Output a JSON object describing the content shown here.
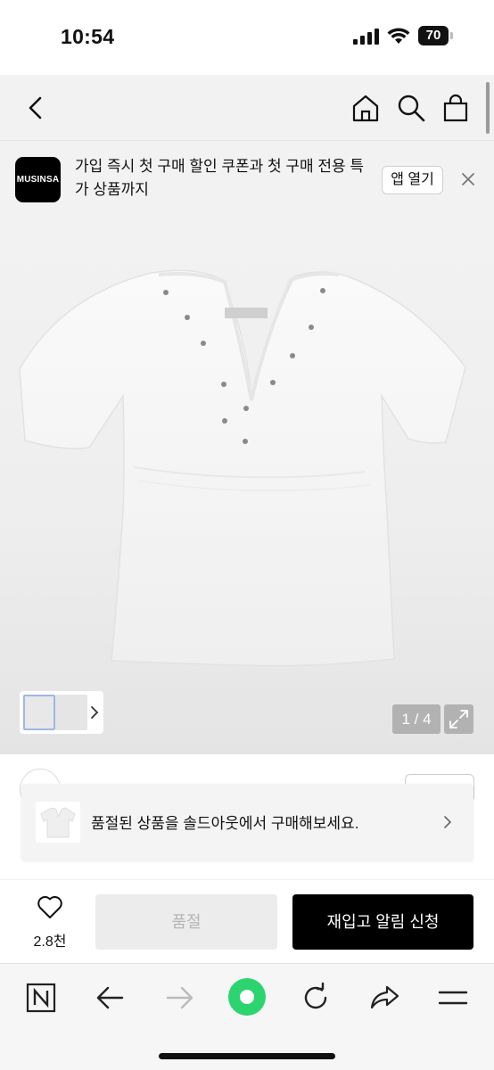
{
  "status_bar": {
    "time": "10:54",
    "battery": "70"
  },
  "top_nav": {
    "back_icon": "chevron-left-icon",
    "home_icon": "home-icon",
    "search_icon": "search-icon",
    "bag_icon": "shopping-bag-icon"
  },
  "promo": {
    "logo_text": "MUSINSA",
    "message": "가입 즉시 첫 구매 할인 쿠폰과 첫 구매 전용 특가 상품까지",
    "open_app_label": "앱 열기",
    "close_icon": "close-icon"
  },
  "gallery": {
    "counter": "1 / 4",
    "expand_icon": "expand-icon",
    "thumb_arrow_icon": "chevron-right-icon"
  },
  "soldout_notice": {
    "text": "품절된 상품을 솔드아웃에서 구매해보세요.",
    "arrow_icon": "chevron-right-icon"
  },
  "action_bar": {
    "like_icon": "heart-icon",
    "like_count": "2.8천",
    "soldout_label": "품절",
    "restock_label": "재입고 알림 신청"
  },
  "bottom_toolbar": {
    "icons": [
      "naver-n-icon",
      "back-arrow-icon",
      "forward-arrow-icon",
      "green-dot-icon",
      "reload-icon",
      "share-icon",
      "menu-icon"
    ]
  },
  "colors": {
    "primary_button": "#000000",
    "disabled_button": "#ececec",
    "naver_green": "#2bd46f"
  }
}
